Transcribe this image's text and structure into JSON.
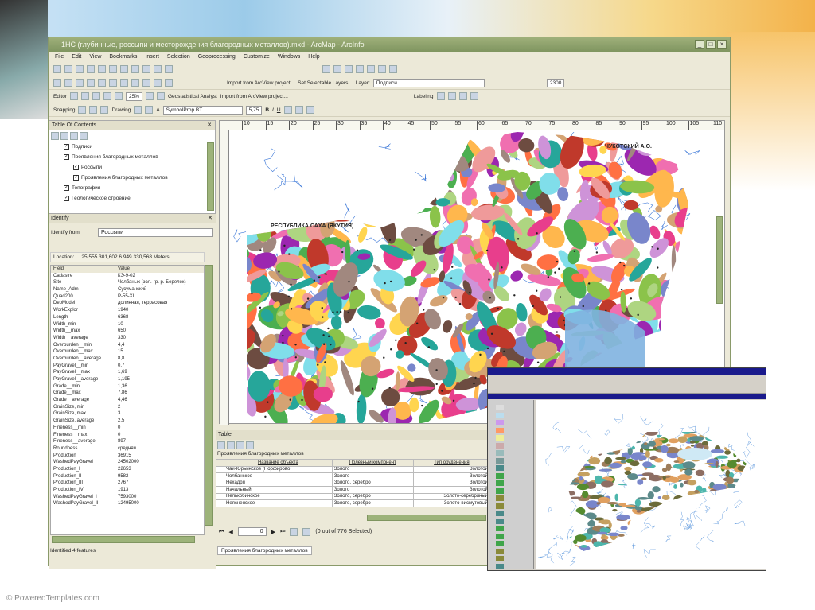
{
  "window": {
    "title": "1НС (глубинные, россыпи и месторождения благородных металлов).mxd - ArcMap - ArcInfo",
    "controls": [
      "_",
      "□",
      "×"
    ]
  },
  "menu": [
    "File",
    "Edit",
    "View",
    "Bookmarks",
    "Insert",
    "Selection",
    "Geoprocessing",
    "Customize",
    "Windows",
    "Help"
  ],
  "toolbars": {
    "import_arcview": "Import from ArcView project...",
    "set_selectable": "Set Selectable Layers...",
    "layer_label": "Layer:",
    "layer_value": "Подписи",
    "scale": "2300",
    "editor": "Editor",
    "zoom_percent": "25%",
    "geostat": "Geostatistical Analyst",
    "import_arcview2": "Import from ArcView project...",
    "labeling": "Labeling",
    "snapping": "Snapping",
    "drawing": "Drawing",
    "font": "SymbolProp BT",
    "font_size": "5,75",
    "bold": "B",
    "italic": "I",
    "underline": "U",
    "text_color": "A"
  },
  "toc": {
    "title": "Table Of Contents",
    "items": [
      "Подписи",
      "Проявления благородных металлов",
      "Россыпи",
      "Проявления благородных металлов",
      "Топография",
      "Геологическое строение"
    ]
  },
  "identify": {
    "title": "Identify",
    "from_label": "Identify from:",
    "from_value": "Россыпи",
    "location_label": "Location:",
    "location_value": "25 555 301,602  6 949 330,568 Meters",
    "col_field": "Field",
    "col_value": "Value",
    "rows": [
      [
        "Cadastre",
        "КЭ-9-02"
      ],
      [
        "Site",
        "Чолбаных (зол.-гр. р. Берелех)"
      ],
      [
        "Name_Adm",
        "Сусуманский"
      ],
      [
        "Quad200",
        "P-55-XI"
      ],
      [
        "DepModel",
        "долинная, террасовая"
      ],
      [
        "WorkExplor",
        "1940"
      ],
      [
        "Length",
        "6368"
      ],
      [
        "Width_min",
        "10"
      ],
      [
        "Width__max",
        "650"
      ],
      [
        "Width__average",
        "330"
      ],
      [
        "Overburden__min",
        "4,4"
      ],
      [
        "Overburden__max",
        "15"
      ],
      [
        "Overburden__average",
        "8,8"
      ],
      [
        "PayGravel__min",
        "0,7"
      ],
      [
        "PayGravel__max",
        "1,69"
      ],
      [
        "PayGravel__average",
        "1,195"
      ],
      [
        "Grade__min",
        "1,36"
      ],
      [
        "Grade__max",
        "7,86"
      ],
      [
        "Grade__average",
        "4,46"
      ],
      [
        "GrainSize, min",
        "2"
      ],
      [
        "GrainSize, max",
        "3"
      ],
      [
        "GrainSize, average",
        "2,5"
      ],
      [
        "Fineness__min",
        "0"
      ],
      [
        "Fineness__max",
        "0"
      ],
      [
        "Fineness__average",
        "897"
      ],
      [
        "Roundness",
        "средняя"
      ],
      [
        "Production",
        "36915"
      ],
      [
        "WashedPayGravel",
        "24502000"
      ],
      [
        "Production_I",
        "22653"
      ],
      [
        "Production_II",
        "9582"
      ],
      [
        "Production_III",
        "2767"
      ],
      [
        "Production_IV",
        "1913"
      ],
      [
        "WashedPayGravel_I",
        "7593000"
      ],
      [
        "WashedPayGravel_II",
        "12495000"
      ]
    ],
    "status": "Identified 4 features"
  },
  "map": {
    "label_sakha": "РЕСПУБЛИКА САХА (ЯКУТИЯ)",
    "label_chukotka": "ЧУКОТСКИЙ А.О.",
    "ruler": [
      "10",
      "15",
      "20",
      "25",
      "30",
      "35",
      "40",
      "45",
      "50",
      "55",
      "60",
      "65",
      "70",
      "75",
      "80",
      "85",
      "90",
      "95",
      "100",
      "105",
      "110"
    ]
  },
  "table": {
    "title": "Table",
    "layer": "Проявления благородных металлов",
    "headers": [
      "Название объекта",
      "Полезный компонент",
      "Тип оруденения"
    ],
    "rows": [
      [
        "Чай-Юрьинское (Порфирово",
        "Золото",
        "Золотой"
      ],
      [
        "Чолбанское",
        "Золото",
        "Золотой"
      ],
      [
        "Нехадря",
        "Золото, серебро",
        "Золотой"
      ],
      [
        "Начальный",
        "Золото",
        "Золотой"
      ],
      [
        "Нелькобинское",
        "Золото, серебро",
        "Золото-серебряный"
      ],
      [
        "Неясненское",
        "Золото, серебро",
        "Золото-висмутовый"
      ]
    ],
    "record": "0",
    "selected": "(0 out of 776 Selected)",
    "tab": "Проявления благородных металлов"
  },
  "footer": "© PoweredTemplates.com"
}
